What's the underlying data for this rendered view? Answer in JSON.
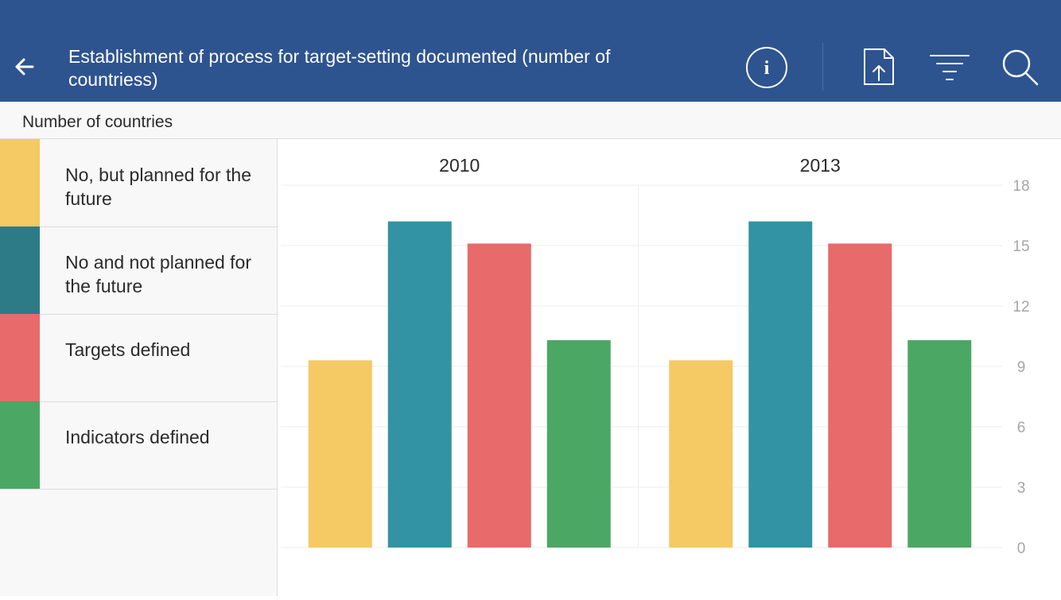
{
  "header": {
    "title": "Establishment of process for target-setting documented (number of countriess)",
    "icons": [
      "back-arrow-icon",
      "info-icon",
      "export-icon",
      "filter-icon",
      "search-icon"
    ]
  },
  "subheader": {
    "label": "Number of countries"
  },
  "colors": {
    "header_bg": "#2e5490",
    "series": [
      "#f5c964",
      "#3193a3",
      "#e86a6a",
      "#4ba764"
    ],
    "legend_swatches": [
      "#f5c964",
      "#2d7b87",
      "#e86a6a",
      "#4ba764"
    ]
  },
  "chart_data": {
    "type": "bar",
    "categories": [
      "2010",
      "2013"
    ],
    "series": [
      {
        "name": "No, but planned for the future",
        "values": [
          9.3,
          9.3
        ]
      },
      {
        "name": "No and not planned for the future",
        "values": [
          16.2,
          16.2
        ]
      },
      {
        "name": "Targets defined",
        "values": [
          15.1,
          15.1
        ]
      },
      {
        "name": "Indicators defined",
        "values": [
          10.3,
          10.3
        ]
      }
    ],
    "ylim": [
      0,
      18
    ],
    "yticks": [
      "18",
      "15",
      "12",
      "9",
      "6",
      "3",
      "0"
    ],
    "grid": true,
    "legend_position": "left"
  }
}
